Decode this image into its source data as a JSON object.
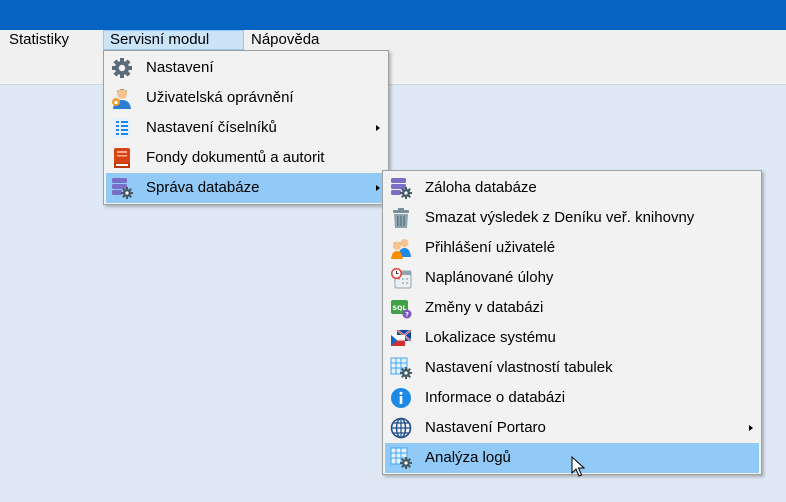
{
  "menubar": {
    "items": [
      {
        "label": "Statistiky"
      },
      {
        "label": "Servisní modul"
      },
      {
        "label": "Nápověda"
      }
    ]
  },
  "service_menu": {
    "items": [
      {
        "label": "Nastavení",
        "icon": "gear-icon"
      },
      {
        "label": "Uživatelská oprávnění",
        "icon": "user-permissions-icon"
      },
      {
        "label": "Nastavení číselníků",
        "icon": "list-icon",
        "submenu": true
      },
      {
        "label": "Fondy dokumentů a autorit",
        "icon": "book-icon"
      },
      {
        "label": "Správa databáze",
        "icon": "database-gear-icon",
        "submenu": true,
        "highlighted": true
      }
    ]
  },
  "database_submenu": {
    "items": [
      {
        "label": "Záloha databáze",
        "icon": "database-gear-icon"
      },
      {
        "label": "Smazat výsledek z Deníku veř. knihovny",
        "icon": "trash-icon"
      },
      {
        "label": "Přihlášení uživatelé",
        "icon": "users-icon"
      },
      {
        "label": "Naplánované úlohy",
        "icon": "calendar-clock-icon"
      },
      {
        "label": "Změny v databázi",
        "icon": "sql-icon"
      },
      {
        "label": "Lokalizace systému",
        "icon": "flags-icon"
      },
      {
        "label": "Nastavení vlastností tabulek",
        "icon": "table-gear-icon"
      },
      {
        "label": "Informace o databázi",
        "icon": "info-icon"
      },
      {
        "label": "Nastavení Portaro",
        "icon": "globe-icon",
        "submenu": true
      },
      {
        "label": "Analýza logů",
        "icon": "table-gear-icon",
        "highlighted": true
      }
    ]
  },
  "colors": {
    "titlebar": "#0563c1",
    "highlight": "#91c9f7",
    "active_menu": "#cce4f7"
  }
}
